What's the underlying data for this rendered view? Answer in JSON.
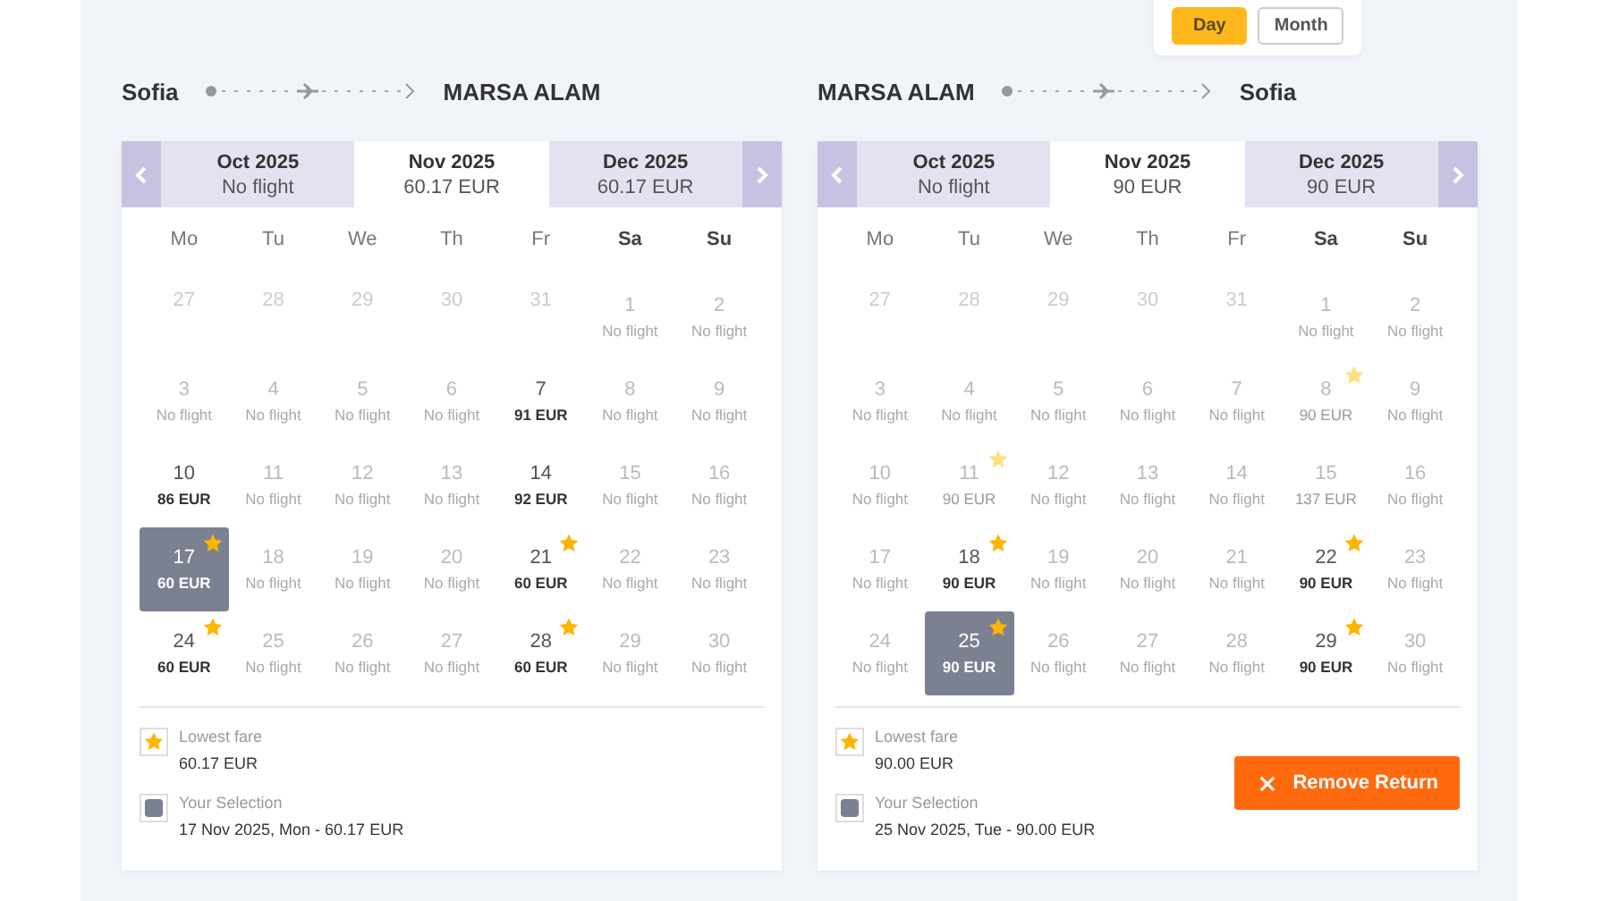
{
  "view_toggle": [
    {
      "label": "Day",
      "selected": true
    },
    {
      "label": "Month",
      "selected": false
    }
  ],
  "calendars": [
    {
      "from": "Sofia",
      "to": "MARSA ALAM",
      "months": [
        {
          "label": "Oct 2025",
          "price": "No flight",
          "selected": false
        },
        {
          "label": "Nov 2025",
          "price": "60.17 EUR",
          "selected": true
        },
        {
          "label": "Dec 2025",
          "price": "60.17 EUR",
          "selected": false
        }
      ],
      "weekdays": [
        {
          "label": "Mo",
          "weekend": false
        },
        {
          "label": "Tu",
          "weekend": false
        },
        {
          "label": "We",
          "weekend": false
        },
        {
          "label": "Th",
          "weekend": false
        },
        {
          "label": "Fr",
          "weekend": false
        },
        {
          "label": "Sa",
          "weekend": true
        },
        {
          "label": "Su",
          "weekend": true
        }
      ],
      "weeks": [
        [
          {
            "day": "27",
            "kind": "other",
            "star": false,
            "selected": false
          },
          {
            "day": "28",
            "kind": "other",
            "star": false,
            "selected": false
          },
          {
            "day": "29",
            "kind": "other",
            "star": false,
            "selected": false
          },
          {
            "day": "30",
            "kind": "other",
            "star": false,
            "selected": false
          },
          {
            "day": "31",
            "kind": "other",
            "star": false,
            "selected": false
          },
          {
            "day": "1",
            "note": "No flight",
            "kind": "none",
            "star": false,
            "selected": false
          },
          {
            "day": "2",
            "note": "No flight",
            "kind": "none",
            "star": false,
            "selected": false
          }
        ],
        [
          {
            "day": "3",
            "note": "No flight",
            "kind": "none",
            "star": false,
            "selected": false
          },
          {
            "day": "4",
            "note": "No flight",
            "kind": "none",
            "star": false,
            "selected": false
          },
          {
            "day": "5",
            "note": "No flight",
            "kind": "none",
            "star": false,
            "selected": false
          },
          {
            "day": "6",
            "note": "No flight",
            "kind": "none",
            "star": false,
            "selected": false
          },
          {
            "day": "7",
            "note": "91 EUR",
            "kind": "fare",
            "star": false,
            "selected": false
          },
          {
            "day": "8",
            "note": "No flight",
            "kind": "none",
            "star": false,
            "selected": false
          },
          {
            "day": "9",
            "note": "No flight",
            "kind": "none",
            "star": false,
            "selected": false
          }
        ],
        [
          {
            "day": "10",
            "note": "86 EUR",
            "kind": "fare",
            "star": false,
            "selected": false
          },
          {
            "day": "11",
            "note": "No flight",
            "kind": "none",
            "star": false,
            "selected": false
          },
          {
            "day": "12",
            "note": "No flight",
            "kind": "none",
            "star": false,
            "selected": false
          },
          {
            "day": "13",
            "note": "No flight",
            "kind": "none",
            "star": false,
            "selected": false
          },
          {
            "day": "14",
            "note": "92 EUR",
            "kind": "fare",
            "star": false,
            "selected": false
          },
          {
            "day": "15",
            "note": "No flight",
            "kind": "none",
            "star": false,
            "selected": false
          },
          {
            "day": "16",
            "note": "No flight",
            "kind": "none",
            "star": false,
            "selected": false
          }
        ],
        [
          {
            "day": "17",
            "note": "60 EUR",
            "kind": "fare",
            "star": true,
            "selected": true
          },
          {
            "day": "18",
            "note": "No flight",
            "kind": "none",
            "star": false,
            "selected": false
          },
          {
            "day": "19",
            "note": "No flight",
            "kind": "none",
            "star": false,
            "selected": false
          },
          {
            "day": "20",
            "note": "No flight",
            "kind": "none",
            "star": false,
            "selected": false
          },
          {
            "day": "21",
            "note": "60 EUR",
            "kind": "fare",
            "star": true,
            "selected": false
          },
          {
            "day": "22",
            "note": "No flight",
            "kind": "none",
            "star": false,
            "selected": false
          },
          {
            "day": "23",
            "note": "No flight",
            "kind": "none",
            "star": false,
            "selected": false
          }
        ],
        [
          {
            "day": "24",
            "note": "60 EUR",
            "kind": "fare",
            "star": true,
            "selected": false
          },
          {
            "day": "25",
            "note": "No flight",
            "kind": "none",
            "star": false,
            "selected": false
          },
          {
            "day": "26",
            "note": "No flight",
            "kind": "none",
            "star": false,
            "selected": false
          },
          {
            "day": "27",
            "note": "No flight",
            "kind": "none",
            "star": false,
            "selected": false
          },
          {
            "day": "28",
            "note": "60 EUR",
            "kind": "fare",
            "star": true,
            "selected": false
          },
          {
            "day": "29",
            "note": "No flight",
            "kind": "none",
            "star": false,
            "selected": false
          },
          {
            "day": "30",
            "note": "No flight",
            "kind": "none",
            "star": false,
            "selected": false
          }
        ]
      ],
      "legend": {
        "lowest_label": "Lowest fare",
        "lowest_value": "60.17 EUR",
        "selection_label": "Your Selection",
        "selection_value": "17 Nov 2025, Mon - 60.17 EUR"
      }
    },
    {
      "from": "MARSA ALAM",
      "to": "Sofia",
      "months": [
        {
          "label": "Oct 2025",
          "price": "No flight",
          "selected": false
        },
        {
          "label": "Nov 2025",
          "price": "90 EUR",
          "selected": true
        },
        {
          "label": "Dec 2025",
          "price": "90 EUR",
          "selected": false
        }
      ],
      "weekdays": [
        {
          "label": "Mo",
          "weekend": false
        },
        {
          "label": "Tu",
          "weekend": false
        },
        {
          "label": "We",
          "weekend": false
        },
        {
          "label": "Th",
          "weekend": false
        },
        {
          "label": "Fr",
          "weekend": false
        },
        {
          "label": "Sa",
          "weekend": true
        },
        {
          "label": "Su",
          "weekend": true
        }
      ],
      "weeks": [
        [
          {
            "day": "27",
            "kind": "other",
            "star": false,
            "selected": false
          },
          {
            "day": "28",
            "kind": "other",
            "star": false,
            "selected": false
          },
          {
            "day": "29",
            "kind": "other",
            "star": false,
            "selected": false
          },
          {
            "day": "30",
            "kind": "other",
            "star": false,
            "selected": false
          },
          {
            "day": "31",
            "kind": "other",
            "star": false,
            "selected": false
          },
          {
            "day": "1",
            "note": "No flight",
            "kind": "none",
            "star": false,
            "selected": false
          },
          {
            "day": "2",
            "note": "No flight",
            "kind": "none",
            "star": false,
            "selected": false
          }
        ],
        [
          {
            "day": "3",
            "note": "No flight",
            "kind": "none",
            "star": false,
            "selected": false
          },
          {
            "day": "4",
            "note": "No flight",
            "kind": "none",
            "star": false,
            "selected": false
          },
          {
            "day": "5",
            "note": "No flight",
            "kind": "none",
            "star": false,
            "selected": false
          },
          {
            "day": "6",
            "note": "No flight",
            "kind": "none",
            "star": false,
            "selected": false
          },
          {
            "day": "7",
            "note": "No flight",
            "kind": "none",
            "star": false,
            "selected": false
          },
          {
            "day": "8",
            "note": "90 EUR",
            "kind": "faded",
            "star": true,
            "selected": false
          },
          {
            "day": "9",
            "note": "No flight",
            "kind": "none",
            "star": false,
            "selected": false
          }
        ],
        [
          {
            "day": "10",
            "note": "No flight",
            "kind": "none",
            "star": false,
            "selected": false
          },
          {
            "day": "11",
            "note": "90 EUR",
            "kind": "faded",
            "star": true,
            "selected": false
          },
          {
            "day": "12",
            "note": "No flight",
            "kind": "none",
            "star": false,
            "selected": false
          },
          {
            "day": "13",
            "note": "No flight",
            "kind": "none",
            "star": false,
            "selected": false
          },
          {
            "day": "14",
            "note": "No flight",
            "kind": "none",
            "star": false,
            "selected": false
          },
          {
            "day": "15",
            "note": "137 EUR",
            "kind": "faded",
            "star": false,
            "selected": false
          },
          {
            "day": "16",
            "note": "No flight",
            "kind": "none",
            "star": false,
            "selected": false
          }
        ],
        [
          {
            "day": "17",
            "note": "No flight",
            "kind": "none",
            "star": false,
            "selected": false
          },
          {
            "day": "18",
            "note": "90 EUR",
            "kind": "fare",
            "star": true,
            "selected": false
          },
          {
            "day": "19",
            "note": "No flight",
            "kind": "none",
            "star": false,
            "selected": false
          },
          {
            "day": "20",
            "note": "No flight",
            "kind": "none",
            "star": false,
            "selected": false
          },
          {
            "day": "21",
            "note": "No flight",
            "kind": "none",
            "star": false,
            "selected": false
          },
          {
            "day": "22",
            "note": "90 EUR",
            "kind": "fare",
            "star": true,
            "selected": false
          },
          {
            "day": "23",
            "note": "No flight",
            "kind": "none",
            "star": false,
            "selected": false
          }
        ],
        [
          {
            "day": "24",
            "note": "No flight",
            "kind": "none",
            "star": false,
            "selected": false
          },
          {
            "day": "25",
            "note": "90 EUR",
            "kind": "fare",
            "star": true,
            "selected": true
          },
          {
            "day": "26",
            "note": "No flight",
            "kind": "none",
            "star": false,
            "selected": false
          },
          {
            "day": "27",
            "note": "No flight",
            "kind": "none",
            "star": false,
            "selected": false
          },
          {
            "day": "28",
            "note": "No flight",
            "kind": "none",
            "star": false,
            "selected": false
          },
          {
            "day": "29",
            "note": "90 EUR",
            "kind": "fare",
            "star": true,
            "selected": false
          },
          {
            "day": "30",
            "note": "No flight",
            "kind": "none",
            "star": false,
            "selected": false
          }
        ]
      ],
      "legend": {
        "lowest_label": "Lowest fare",
        "lowest_value": "90.00 EUR",
        "selection_label": "Your Selection",
        "selection_value": "25 Nov 2025, Tue - 90.00 EUR"
      },
      "remove_button": "Remove Return"
    }
  ]
}
